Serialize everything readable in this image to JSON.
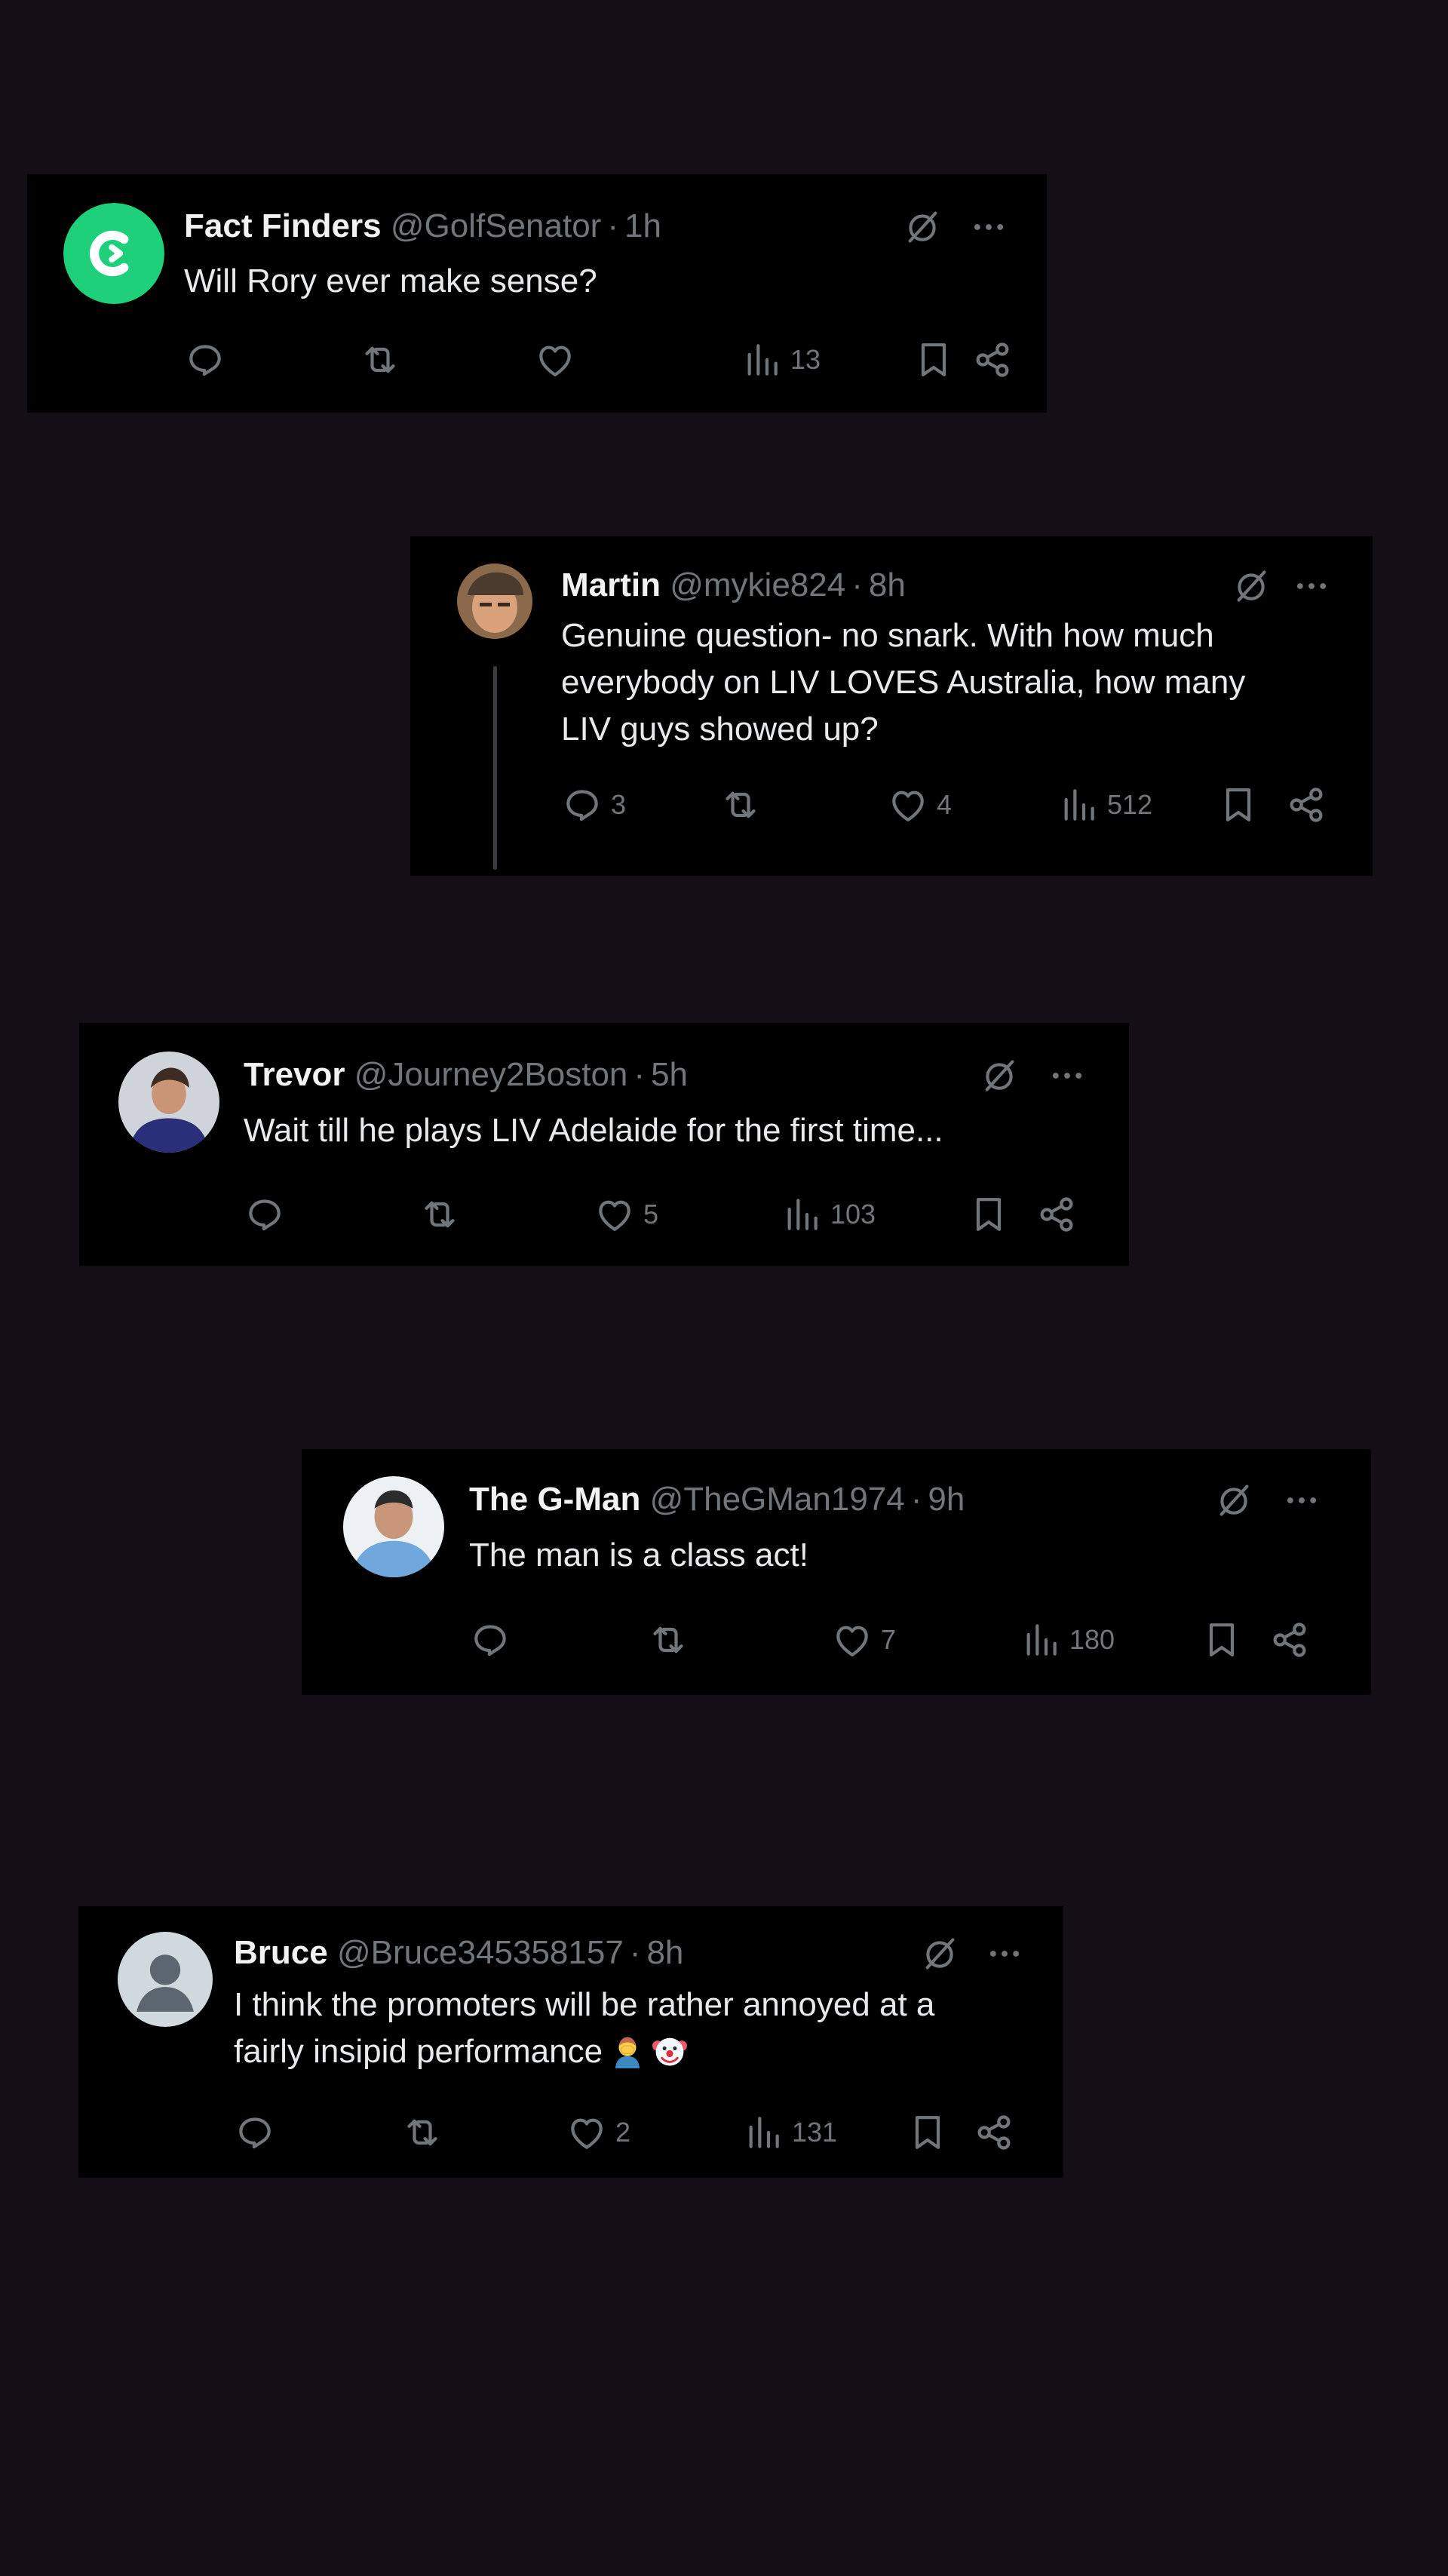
{
  "colors": {
    "background": "#140f16",
    "card": "#000000",
    "text": "#e7e9ea",
    "muted": "#71767b",
    "fact_finders_green": "#1fd07a"
  },
  "tweets": [
    {
      "name": "Fact Finders",
      "handle": "@GolfSenator",
      "separator": "·",
      "time": "1h",
      "avatar": "green-logo-avatar",
      "text": [
        "Will Rory ever make sense?"
      ],
      "replies": "",
      "reposts": "",
      "likes": "",
      "views": "13"
    },
    {
      "name": "Martin",
      "handle": "@mykie824",
      "separator": "·",
      "time": "8h",
      "avatar": "photo-avatar",
      "text": [
        "Genuine question- no snark. With how much",
        "everybody on LIV LOVES Australia, how many",
        "LIV guys showed up?"
      ],
      "replies": "3",
      "reposts": "",
      "likes": "4",
      "views": "512"
    },
    {
      "name": "Trevor",
      "handle": "@Journey2Boston",
      "separator": "·",
      "time": "5h",
      "avatar": "photo-avatar",
      "text": [
        "Wait till he plays LIV Adelaide for the first time..."
      ],
      "replies": "",
      "reposts": "",
      "likes": "5",
      "views": "103"
    },
    {
      "name": "The G-Man",
      "handle": "@TheGMan1974",
      "separator": "·",
      "time": "9h",
      "avatar": "photo-avatar",
      "text": [
        "The man is a class act!"
      ],
      "replies": "",
      "reposts": "",
      "likes": "7",
      "views": "180"
    },
    {
      "name": "Bruce",
      "handle": "@Bruce345358157",
      "separator": "·",
      "time": "8h",
      "avatar": "default-avatar",
      "text": [
        "I think the promoters will be rather annoyed at a",
        "fairly insipid performance"
      ],
      "emojis": [
        "man-facepalming-emoji",
        "clown-face-emoji"
      ],
      "replies": "",
      "reposts": "",
      "likes": "2",
      "views": "131"
    }
  ],
  "icons": [
    "reply-icon",
    "repost-icon",
    "like-icon",
    "views-icon",
    "bookmark-icon",
    "share-icon",
    "grok-icon",
    "more-icon"
  ]
}
